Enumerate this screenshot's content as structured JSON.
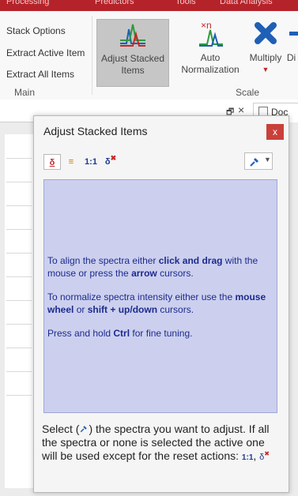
{
  "topbar": {
    "color": "#b5232a",
    "items": [
      "Processing",
      "Predictors",
      "Tools",
      "Data Analysis"
    ]
  },
  "ribbon": {
    "main_items": [
      "Stack Options",
      "Extract Active Item",
      "Extract All Items"
    ],
    "main_group_label": "Main",
    "adjust_stacked": {
      "line1": "Adjust Stacked",
      "line2": "Items"
    },
    "auto_norm": {
      "line1": "Auto",
      "line2": "Normalization"
    },
    "multiply": {
      "label": "Multiply"
    },
    "di": {
      "label": "Di"
    },
    "scale_group_label": "Scale"
  },
  "window_controls": {
    "restore": "🗗",
    "close": "×"
  },
  "doc_tab": {
    "label": "Doc"
  },
  "dialog": {
    "title": "Adjust Stacked Items",
    "close": "x",
    "toolbar": {
      "delta_underline": "δ",
      "align": "≡",
      "ratio": "1:1",
      "delta_reset": "δ"
    },
    "info": {
      "p1_a": "To align the spectra either ",
      "p1_b": "click and drag",
      "p1_c": " with the mouse or press the ",
      "p1_d": "arrow",
      "p1_e": " cursors.",
      "p2_a": "To normalize spectra intensity either use the ",
      "p2_b": "mouse wheel",
      "p2_c": " or ",
      "p2_d": "shift + up/down",
      "p2_e": " cursors.",
      "p3_a": "Press and hold ",
      "p3_b": "Ctrl",
      "p3_c": " for fine tuning."
    },
    "bottom": {
      "a": "Select (",
      "b": ") the spectra you want to adjust. If all the spectra or none is selected the active one will be used except for the reset actions: ",
      "ratio": "1:1",
      "comma": ", ",
      "delta": "δ"
    },
    "colors": {
      "info_bg": "#ccd0ee",
      "info_text": "#1d2a8f",
      "accent_red": "#c9403a"
    }
  }
}
